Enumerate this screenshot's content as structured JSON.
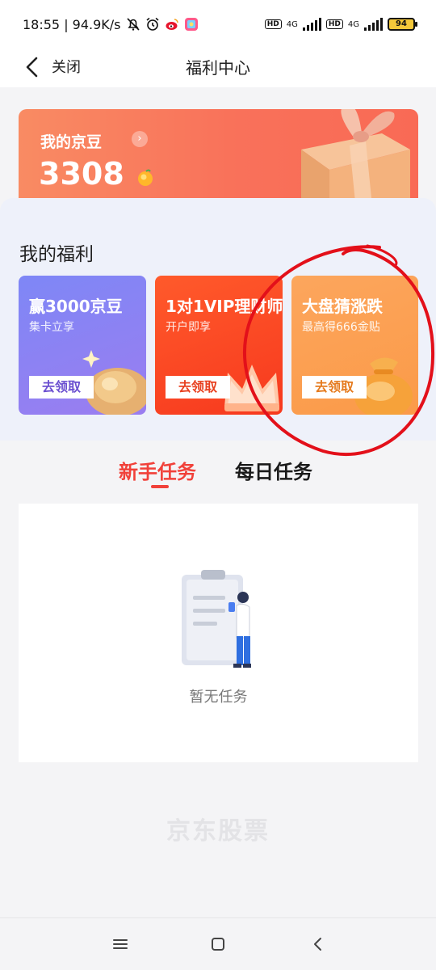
{
  "status_bar": {
    "time_speed": "18:55 | 94.9K/s",
    "network_1": "4G",
    "network_2": "4G",
    "hd": "HD",
    "battery": "94"
  },
  "nav": {
    "close_label": "关闭",
    "title": "福利中心"
  },
  "bean_card": {
    "title": "我的京豆",
    "count": "3308"
  },
  "welfare": {
    "title": "我的福利",
    "cards": [
      {
        "title": "赢3000京豆",
        "subtitle": "集卡立享",
        "button": "去领取"
      },
      {
        "title": "1对1VIP理财师",
        "subtitle": "开户即享",
        "button": "去领取"
      },
      {
        "title": "大盘猜涨跌",
        "subtitle": "最高得666金贴",
        "button": "去领取"
      }
    ]
  },
  "tabs": {
    "new": "新手任务",
    "daily": "每日任务"
  },
  "tasks": {
    "empty_text": "暂无任务"
  },
  "footer": {
    "brand": "京东股票"
  },
  "colors": {
    "accent": "#f1413a",
    "annotation_circle": "#e3101a"
  }
}
